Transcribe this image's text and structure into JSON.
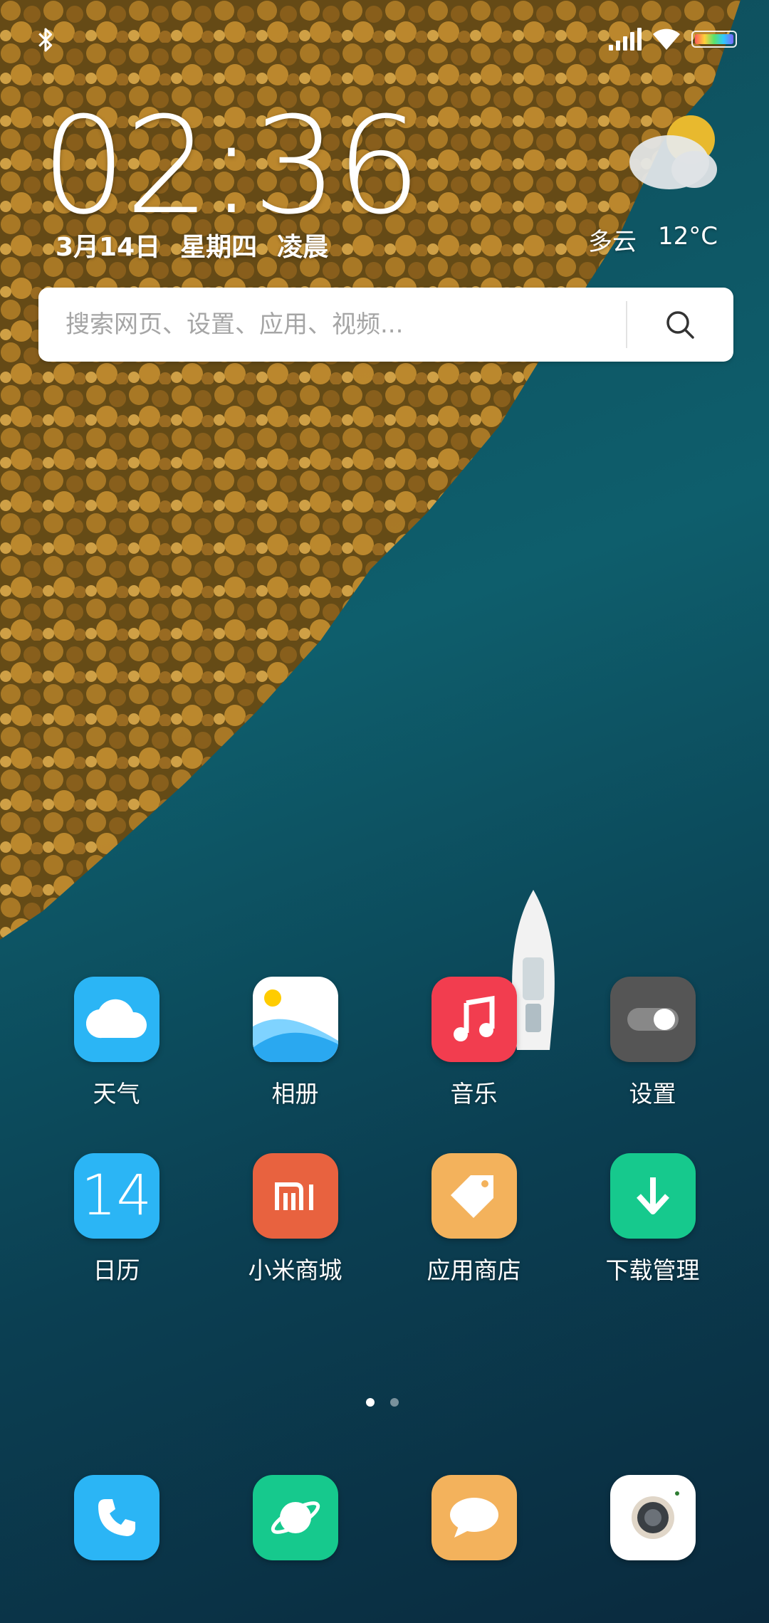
{
  "status_bar": {
    "bluetooth_icon": "bluetooth-icon",
    "signal_icon": "cellular-signal-icon",
    "wifi_icon": "wifi-icon",
    "battery_icon": "battery-icon"
  },
  "clock": {
    "time": "02:36",
    "date": "3月14日",
    "weekday": "星期四",
    "period": "凌晨"
  },
  "weather": {
    "icon": "partly-cloudy-icon",
    "condition": "多云",
    "temperature": "12°C"
  },
  "search": {
    "placeholder": "搜索网页、设置、应用、视频...",
    "icon": "search-icon"
  },
  "apps": [
    {
      "label": "天气",
      "icon": "weather-icon",
      "color": "#2bb5f5"
    },
    {
      "label": "相册",
      "icon": "gallery-icon",
      "color": "#ffffff"
    },
    {
      "label": "音乐",
      "icon": "music-icon",
      "color": "#f23d4f"
    },
    {
      "label": "设置",
      "icon": "settings-icon",
      "color": "#555555"
    },
    {
      "label": "日历",
      "icon": "calendar-icon",
      "color": "#2bb5f5",
      "day": "14"
    },
    {
      "label": "小米商城",
      "icon": "mi-store-icon",
      "color": "#e8623f",
      "text": "mi"
    },
    {
      "label": "应用商店",
      "icon": "app-store-icon",
      "color": "#f3b25c"
    },
    {
      "label": "下载管理",
      "icon": "download-icon",
      "color": "#16c98d"
    }
  ],
  "pager": {
    "pages": 2,
    "current": 1
  },
  "dock": [
    {
      "icon": "phone-icon",
      "color": "#2bb5f5"
    },
    {
      "icon": "browser-icon",
      "color": "#16c98d"
    },
    {
      "icon": "messages-icon",
      "color": "#f3b25c"
    },
    {
      "icon": "camera-icon",
      "color": "#ffffff"
    }
  ]
}
